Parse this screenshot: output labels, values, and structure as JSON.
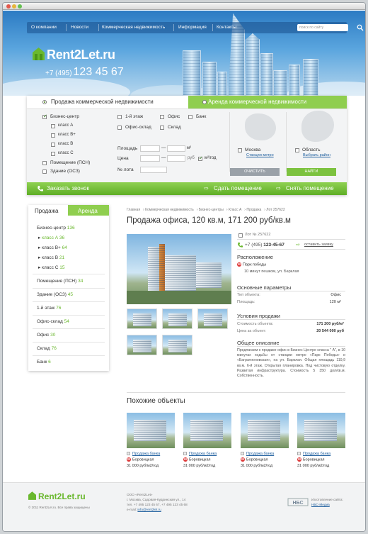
{
  "nav": {
    "items": [
      "О компании",
      "Новости",
      "Коммерческая недвижимость",
      "Информация",
      "Контакты"
    ],
    "search_placeholder": "поиск по сайту"
  },
  "logo": {
    "name": "Rent2Let.ru"
  },
  "phone": {
    "code": "+7 (495)",
    "number": "123 45 67"
  },
  "search": {
    "tab_sale": "Продажа коммерческой недвижимости",
    "tab_rent": "Аренда коммерческой недвижимости"
  },
  "filters": {
    "business_center": "Бизнес-центр",
    "classes": [
      "класс А",
      "класс В+",
      "класс В",
      "класс С"
    ],
    "premises": "Помещение (ПСН)",
    "building": "Здание (ОСЗ)",
    "floor1": "1-й этаж",
    "office": "Офис",
    "bank": "Банк",
    "office_warehouse": "Офис-склад",
    "warehouse": "Склад",
    "area": "Площадь",
    "price": "Цена",
    "lot": "№ лота",
    "dash": "—",
    "m2": "м²",
    "currency": "руб",
    "per_m2": "м²/год",
    "moscow": "Москва",
    "metro_link": "Станции метро",
    "region": "Область",
    "region_link": "Выбрать район",
    "clear": "ОЧИСТИТЬ",
    "find": "НАЙТИ"
  },
  "greenbar": {
    "call": "Заказать звонок",
    "rent_out": "Сдать помещение",
    "rent": "Снять помещение"
  },
  "sidebar": {
    "tab_sale": "Продажа",
    "tab_rent": "Аренда",
    "items": [
      {
        "label": "Бизнес-центр",
        "count": "136"
      },
      {
        "label": "класс А",
        "count": "36"
      },
      {
        "label": "класс В+",
        "count": "64"
      },
      {
        "label": "класс В",
        "count": "21"
      },
      {
        "label": "класс С",
        "count": "15"
      },
      {
        "label": "Помещение (ПСН)",
        "count": "34"
      },
      {
        "label": "Здание (ОСЗ)",
        "count": "45"
      },
      {
        "label": "1-й этаж",
        "count": "76"
      },
      {
        "label": "Офис-склад",
        "count": "54"
      },
      {
        "label": "Офис",
        "count": "30"
      },
      {
        "label": "Склад",
        "count": "76"
      },
      {
        "label": "Банк",
        "count": "6"
      }
    ]
  },
  "breadcrumb": [
    "Главная",
    "Коммерческая недвижимость",
    "Бизнес-центры",
    "Класс А",
    "Продажа",
    "Лот 257622"
  ],
  "listing": {
    "title": "Продажа офиса, 120 кв.м, 171 200 руб/кв.м",
    "lot": "Лот № 257622",
    "phone_code": "+7 (495)",
    "phone_num": "123-45-67",
    "request": "оставить заявку",
    "location_h": "Расположение",
    "metro": "Парк победы",
    "walk": "10 минут пешком, ул. Барклая",
    "params_h": "Основные параметры",
    "type_k": "Тип объекта:",
    "type_v": "Офис",
    "area_k": "Площадь:",
    "area_v": "120 м²",
    "terms_h": "Условия продажи",
    "cost_k": "Стоимость объекта:",
    "cost_v": "171 200 руб/м²",
    "total_k": "Цена за объект:",
    "total_v": "20 544 000 руб",
    "desc_h": "Общее описание",
    "desc": "Предлагаем к продаже офис в Бизнес Центре класса \" А\", в 10 минутах ходьбы от станции метро «Парк Победы» и «Багратионовская», на ул. Барклая. Общая площадь 119,9 кв.м. 6-й этаж. Открытая планировка. Под чистовую отделку. Развитая инфраструктура. Стоимость 5 350 дол/кв.м. Собственность."
  },
  "similar": {
    "title": "Похожие объекты",
    "cards": [
      {
        "name": "Продажа банка",
        "metro": "Боровицкая",
        "price": "31 000 руб/м2/год"
      },
      {
        "name": "Продажа банка",
        "metro": "Боровицкая",
        "price": "31 000 руб/м2/год"
      },
      {
        "name": "Продажа банка",
        "metro": "Боровицкая",
        "price": "31 000 руб/м2/год"
      },
      {
        "name": "Продажа банка",
        "metro": "Боровицкая",
        "price": "31 000 руб/м2/год"
      }
    ]
  },
  "footer": {
    "logo": "Rent2Let.ru",
    "copyright": "© 2011 Rent2Let.ru. Все права защищены",
    "company": "ООО «Rent2Let»",
    "address": "г. Москва, Садовая-Кудринская ул., 14",
    "phones": "тел. +7 495 123 45 67, +7 495 123 45 68",
    "email_label": "e-mail:",
    "email": "info@rent2let.ru",
    "dev_label": "Изготовление сайта:",
    "dev": "НБС-Медиа"
  },
  "colors": {
    "accent_green": "#8fce4f",
    "link_blue": "#1f5f9e",
    "sky": "#2c7bc3"
  }
}
